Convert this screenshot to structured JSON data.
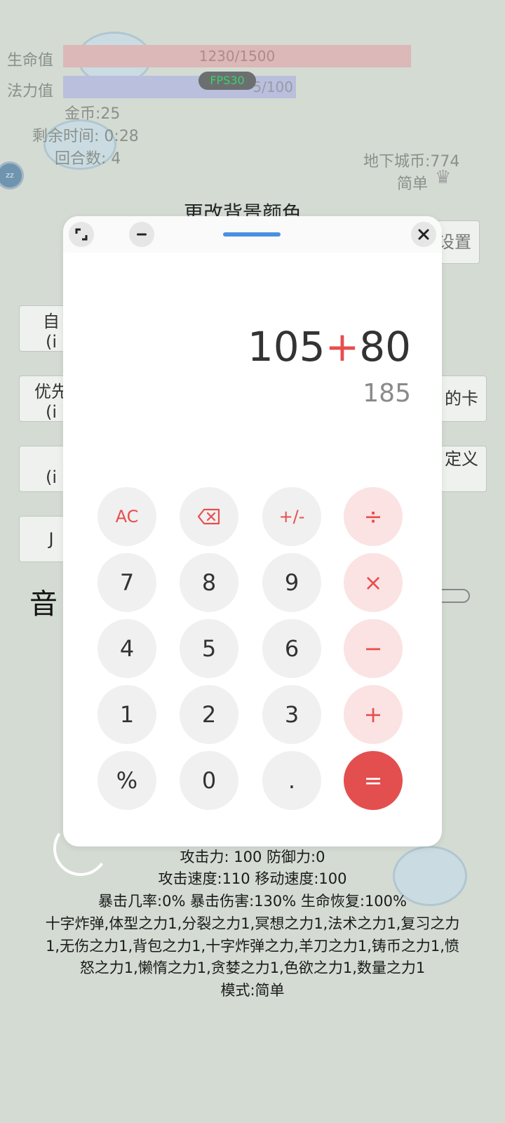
{
  "hud": {
    "hp_label": "生命值",
    "hp_value": "1230/1500",
    "mp_label": "法力值",
    "mp_value": "5/100",
    "fps": "FPS30",
    "gold": "金币:25",
    "time_left": "剩余时间: 0:28",
    "rounds": "回合数: 4",
    "dungeon_coins": "地下城币:774",
    "difficulty": "简单",
    "avatar_text": "zz"
  },
  "settings": {
    "title": "更改背景颜色",
    "settings_button": "设置",
    "left_buttons": [
      "自",
      "(i",
      "优先",
      "(i",
      "",
      "(i",
      "J"
    ],
    "right_button_1": "的卡",
    "right_button_2": "定义",
    "volume_label": "音"
  },
  "stats": {
    "line1": "攻击力: 100 防御力:0",
    "line2": "攻击速度:110 移动速度:100",
    "line3": "暴击几率:0% 暴击伤害:130% 生命恢复:100%",
    "line4": "十字炸弹,体型之力1,分裂之力1,冥想之力1,法术之力1,复习之力",
    "line5": "1,无伤之力1,背包之力1,十字炸弹之力,羊刀之力1,铸币之力1,愤",
    "line6": "怒之力1,懒惰之力1,贪婪之力1,色欲之力1,数量之力1",
    "line7": "模式:简单"
  },
  "calculator": {
    "expression_left": "105",
    "expression_op": "+",
    "expression_right": "80",
    "result": "185",
    "keys": {
      "ac": "AC",
      "sign": "+/-",
      "divide": "÷",
      "seven": "7",
      "eight": "8",
      "nine": "9",
      "multiply": "×",
      "four": "4",
      "five": "5",
      "six": "6",
      "minus": "−",
      "one": "1",
      "two": "2",
      "three": "3",
      "plus": "+",
      "percent": "%",
      "zero": "0",
      "dot": ".",
      "equals": "="
    },
    "colors": {
      "accent": "#e34f4f",
      "op_bg": "#fbe3e3",
      "handle": "#4a90e2"
    }
  }
}
